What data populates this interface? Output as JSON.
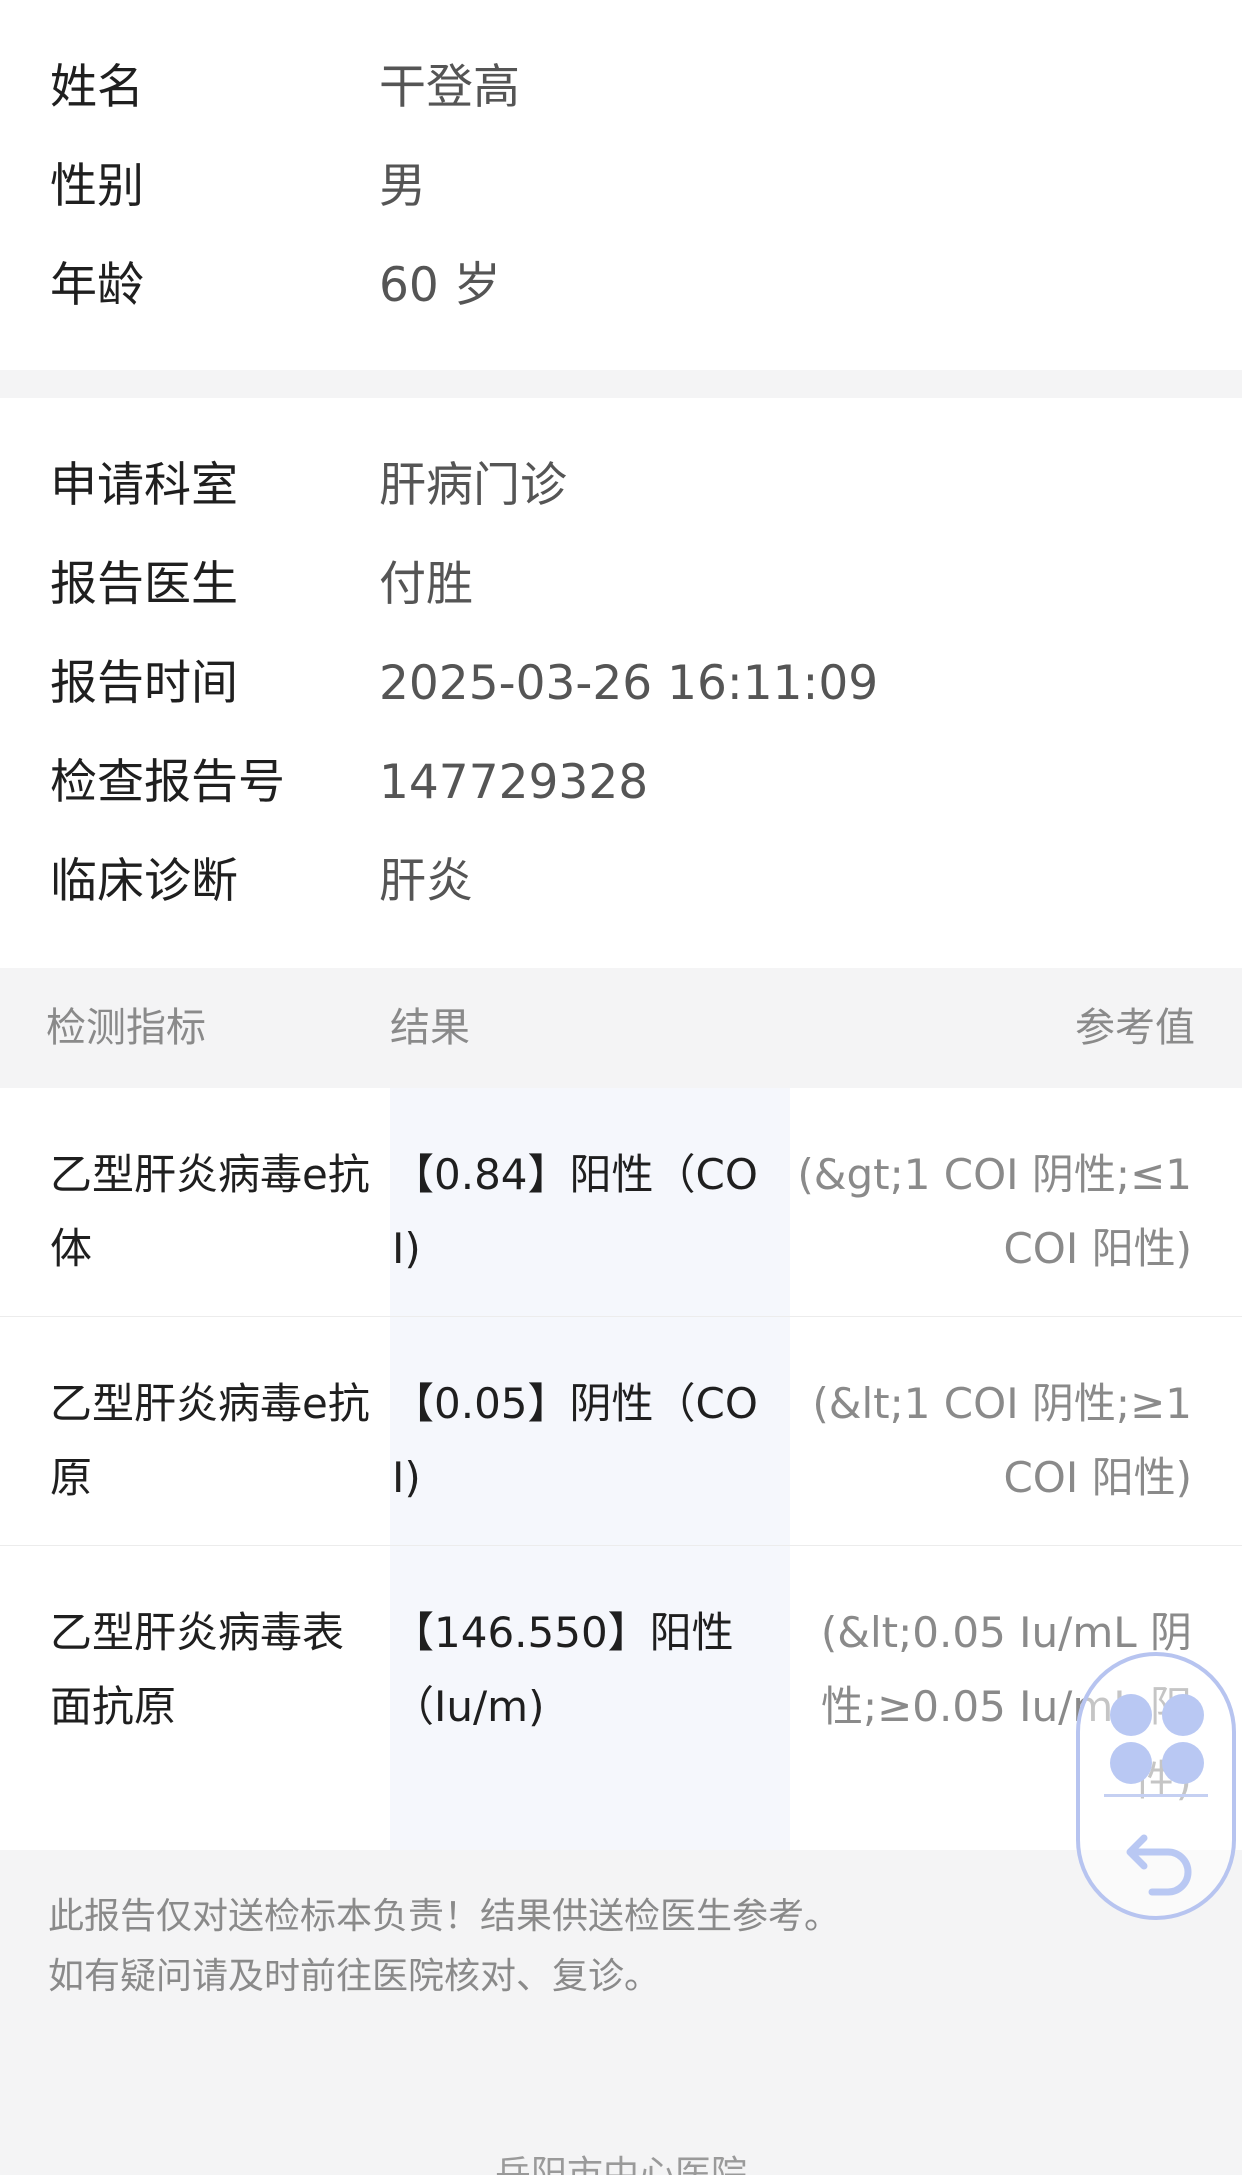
{
  "patient": {
    "fields": [
      {
        "label": "姓名",
        "value": "干登高"
      },
      {
        "label": "性别",
        "value": "男"
      },
      {
        "label": "年龄",
        "value": "60 岁"
      }
    ]
  },
  "report": {
    "fields": [
      {
        "label": "申请科室",
        "value": "肝病门诊"
      },
      {
        "label": "报告医生",
        "value": "付胜"
      },
      {
        "label": "报告时间",
        "value": "2025-03-26 16:11:09"
      },
      {
        "label": "检查报告号",
        "value": "147729328"
      },
      {
        "label": "临床诊断",
        "value": "肝炎"
      }
    ]
  },
  "table": {
    "headers": {
      "name": "检测指标",
      "result": "结果",
      "reference": "参考值"
    },
    "rows": [
      {
        "name": "乙型肝炎病毒e抗体",
        "result": "【0.84】阳性（COI)",
        "reference": "(&gt;1 COI 阴性;≤1 COI 阳性)"
      },
      {
        "name": "乙型肝炎病毒e抗原",
        "result": "【0.05】阴性（COI)",
        "reference": "(&lt;1 COI 阴性;≥1 COI 阳性)"
      },
      {
        "name": "乙型肝炎病毒表面抗原",
        "result": "【146.550】阳性（Iu/m)",
        "reference": "(&lt;0.05 Iu/mL 阴性;≥0.05 Iu/mL 阳性)"
      }
    ]
  },
  "footer": {
    "note_line1": "此报告仅对送检标本负责！结果供送检医生参考。",
    "note_line2": "如有疑问请及时前往医院核对、复诊。",
    "hospital": "岳阳市中心医院"
  },
  "floating_widget": {
    "icons": [
      "apps-grid-icon",
      "back-arrow-icon"
    ],
    "color": "#b9c8f3"
  }
}
